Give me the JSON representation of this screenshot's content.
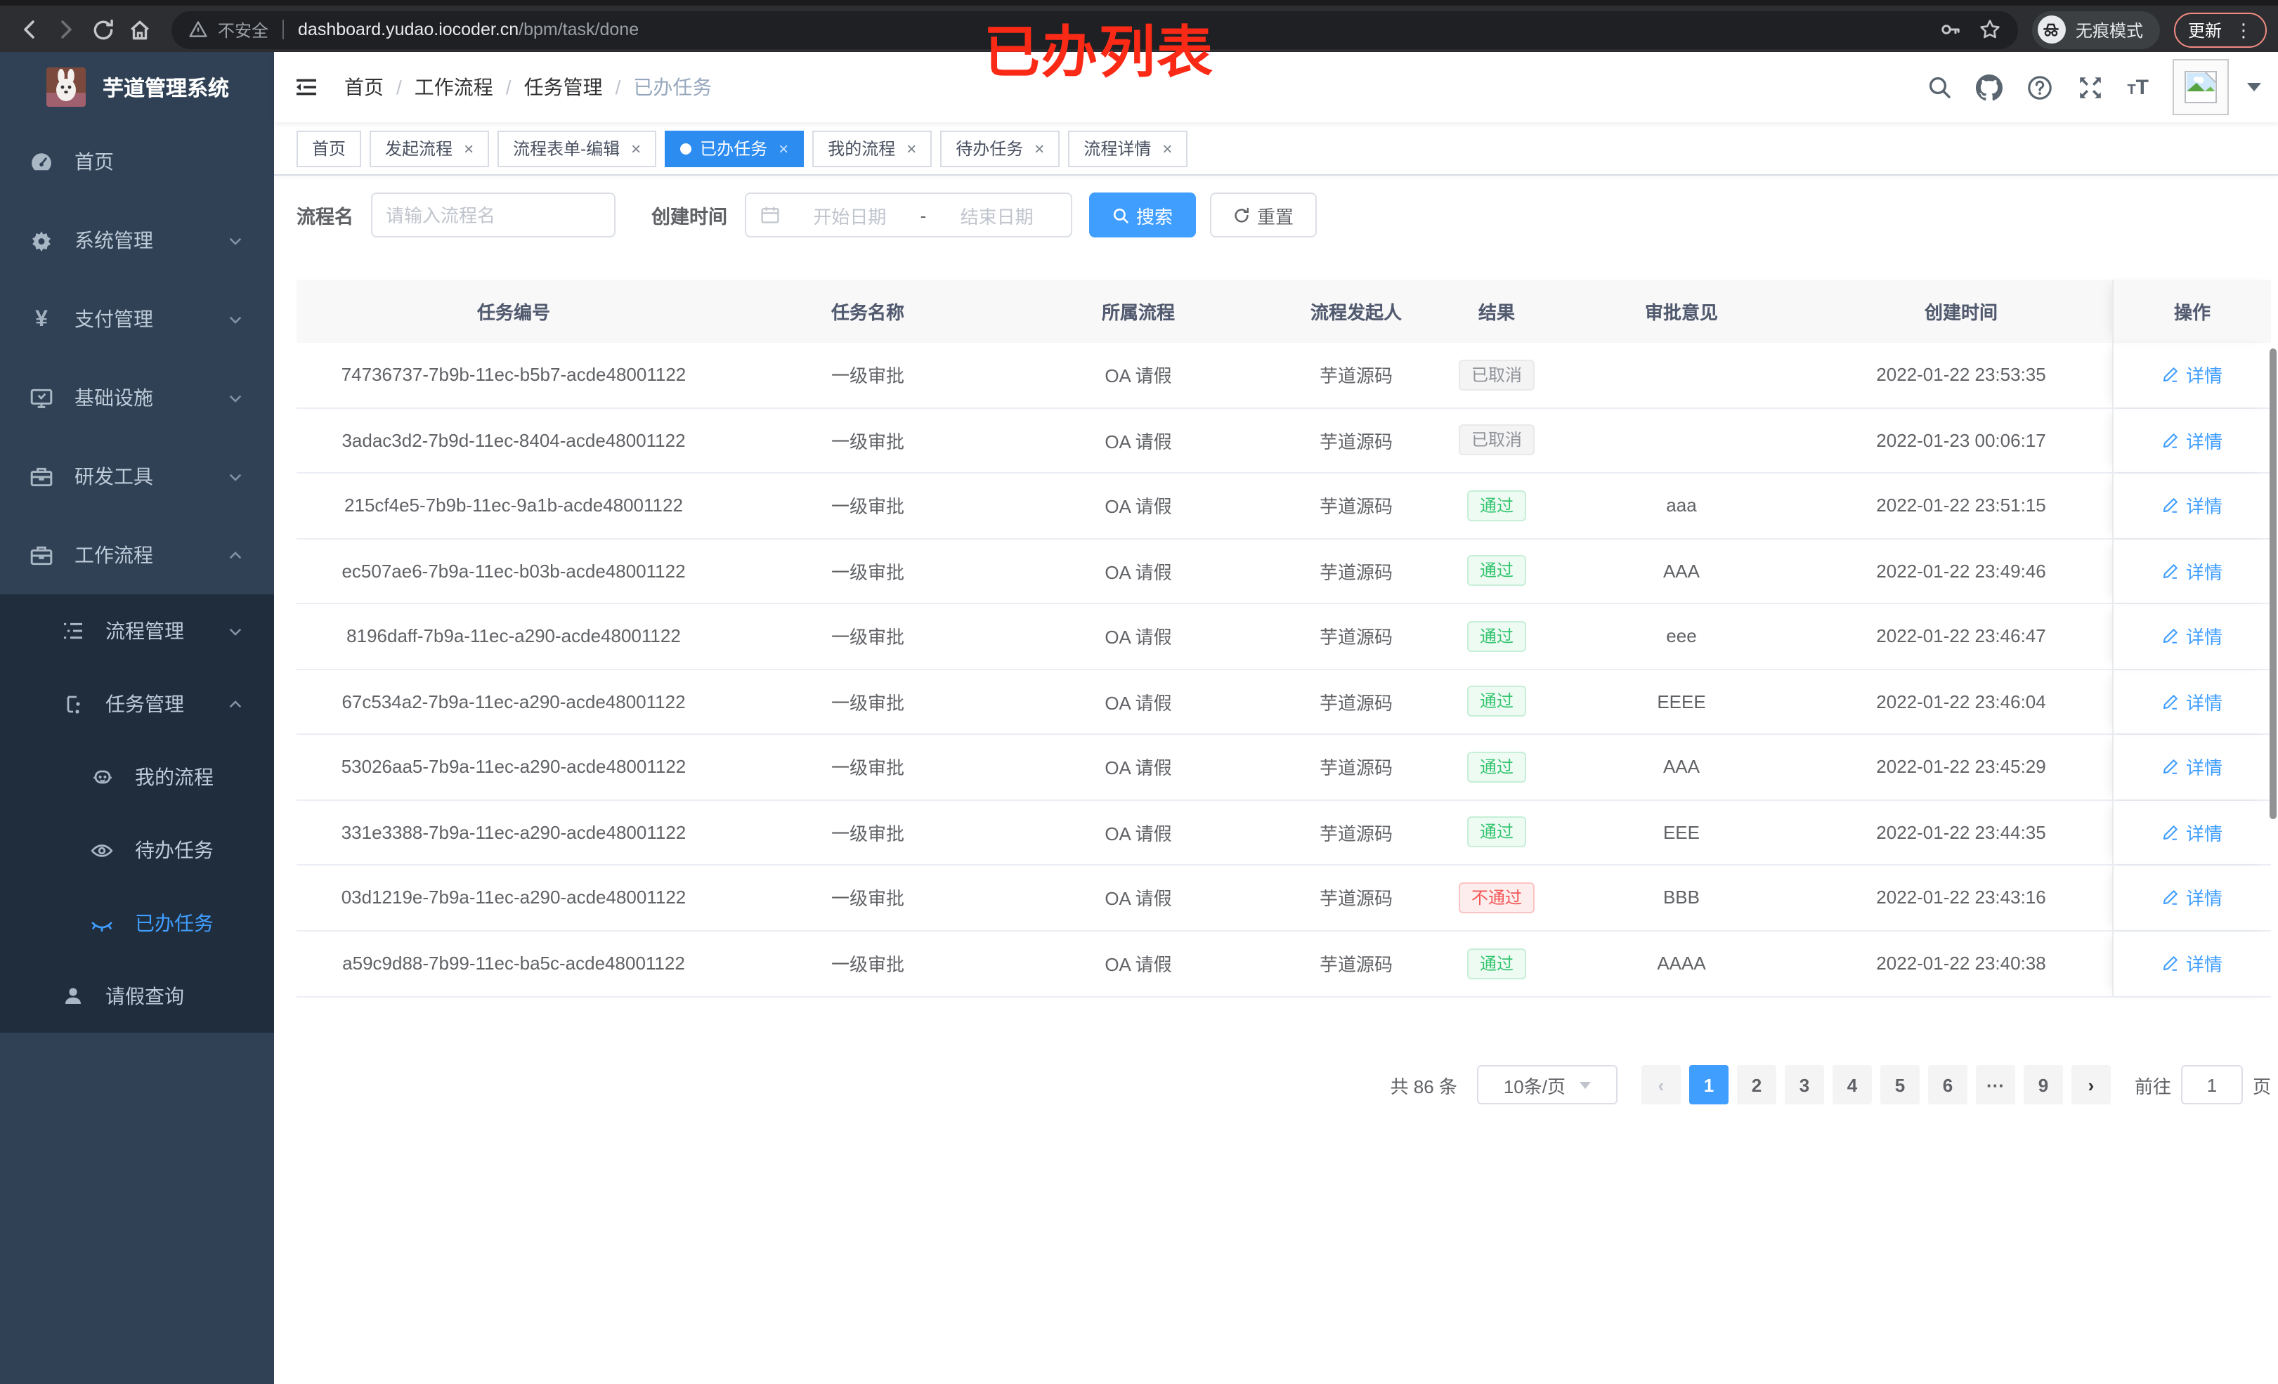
{
  "browser": {
    "security_label": "不安全",
    "url_host": "dashboard.yudao.iocoder.cn",
    "url_path": "/bpm/task/done",
    "incognito_label": "无痕模式",
    "update_label": "更新"
  },
  "annotation": {
    "text": "已办列表"
  },
  "sidebar": {
    "logo_title": "芋道管理系统",
    "menu": [
      {
        "label": "首页"
      },
      {
        "label": "系统管理"
      },
      {
        "label": "支付管理"
      },
      {
        "label": "基础设施"
      },
      {
        "label": "研发工具"
      },
      {
        "label": "工作流程"
      },
      {
        "label": "流程管理"
      },
      {
        "label": "任务管理"
      },
      {
        "label": "我的流程"
      },
      {
        "label": "待办任务"
      },
      {
        "label": "已办任务"
      },
      {
        "label": "请假查询"
      }
    ]
  },
  "header": {
    "breadcrumb": [
      "首页",
      "工作流程",
      "任务管理",
      "已办任务"
    ]
  },
  "tabs": [
    {
      "label": "首页",
      "closable": false,
      "active": false
    },
    {
      "label": "发起流程",
      "closable": true,
      "active": false
    },
    {
      "label": "流程表单-编辑",
      "closable": true,
      "active": false
    },
    {
      "label": "已办任务",
      "closable": true,
      "active": true
    },
    {
      "label": "我的流程",
      "closable": true,
      "active": false
    },
    {
      "label": "待办任务",
      "closable": true,
      "active": false
    },
    {
      "label": "流程详情",
      "closable": true,
      "active": false
    }
  ],
  "filters": {
    "name_label": "流程名",
    "name_placeholder": "请输入流程名",
    "time_label": "创建时间",
    "start_placeholder": "开始日期",
    "range_separator": "-",
    "end_placeholder": "结束日期",
    "search_label": "搜索",
    "reset_label": "重置"
  },
  "table": {
    "columns": [
      "任务编号",
      "任务名称",
      "所属流程",
      "流程发起人",
      "结果",
      "审批意见",
      "创建时间",
      "操作"
    ],
    "detail_label": "详情",
    "rows": [
      {
        "id": "74736737-7b9b-11ec-b5b7-acde48001122",
        "name": "一级审批",
        "process": "OA 请假",
        "starter": "芋道源码",
        "result": "已取消",
        "result_type": "info",
        "opinion": "",
        "time": "2022-01-22 23:53:35"
      },
      {
        "id": "3adac3d2-7b9d-11ec-8404-acde48001122",
        "name": "一级审批",
        "process": "OA 请假",
        "starter": "芋道源码",
        "result": "已取消",
        "result_type": "info",
        "opinion": "",
        "time": "2022-01-23 00:06:17"
      },
      {
        "id": "215cf4e5-7b9b-11ec-9a1b-acde48001122",
        "name": "一级审批",
        "process": "OA 请假",
        "starter": "芋道源码",
        "result": "通过",
        "result_type": "success",
        "opinion": "aaa",
        "time": "2022-01-22 23:51:15"
      },
      {
        "id": "ec507ae6-7b9a-11ec-b03b-acde48001122",
        "name": "一级审批",
        "process": "OA 请假",
        "starter": "芋道源码",
        "result": "通过",
        "result_type": "success",
        "opinion": "AAA",
        "time": "2022-01-22 23:49:46"
      },
      {
        "id": "8196daff-7b9a-11ec-a290-acde48001122",
        "name": "一级审批",
        "process": "OA 请假",
        "starter": "芋道源码",
        "result": "通过",
        "result_type": "success",
        "opinion": "eee",
        "time": "2022-01-22 23:46:47"
      },
      {
        "id": "67c534a2-7b9a-11ec-a290-acde48001122",
        "name": "一级审批",
        "process": "OA 请假",
        "starter": "芋道源码",
        "result": "通过",
        "result_type": "success",
        "opinion": "EEEE",
        "time": "2022-01-22 23:46:04"
      },
      {
        "id": "53026aa5-7b9a-11ec-a290-acde48001122",
        "name": "一级审批",
        "process": "OA 请假",
        "starter": "芋道源码",
        "result": "通过",
        "result_type": "success",
        "opinion": "AAA",
        "time": "2022-01-22 23:45:29"
      },
      {
        "id": "331e3388-7b9a-11ec-a290-acde48001122",
        "name": "一级审批",
        "process": "OA 请假",
        "starter": "芋道源码",
        "result": "通过",
        "result_type": "success",
        "opinion": "EEE",
        "time": "2022-01-22 23:44:35"
      },
      {
        "id": "03d1219e-7b9a-11ec-a290-acde48001122",
        "name": "一级审批",
        "process": "OA 请假",
        "starter": "芋道源码",
        "result": "不通过",
        "result_type": "danger",
        "opinion": "BBB",
        "time": "2022-01-22 23:43:16"
      },
      {
        "id": "a59c9d88-7b99-11ec-ba5c-acde48001122",
        "name": "一级审批",
        "process": "OA 请假",
        "starter": "芋道源码",
        "result": "通过",
        "result_type": "success",
        "opinion": "AAAA",
        "time": "2022-01-22 23:40:38"
      }
    ]
  },
  "pagination": {
    "total_label": "共 86 条",
    "page_size": "10条/页",
    "pages": [
      "1",
      "2",
      "3",
      "4",
      "5",
      "6",
      "···",
      "9"
    ],
    "active_page": "1",
    "prev_icon": "‹",
    "next_icon": "›",
    "goto_label": "前往",
    "goto_value": "1",
    "goto_suffix": "页"
  },
  "colors": {
    "primary": "#409eff",
    "tab_active": "#2d8cf0",
    "sidebar_bg": "#304156",
    "submenu_bg": "#1f2d3d",
    "success_text": "#34c56f",
    "danger_text": "#f45454",
    "info_text": "#909399",
    "annotation_red": "#fb2a16",
    "update_chip_border": "#f28b82"
  }
}
